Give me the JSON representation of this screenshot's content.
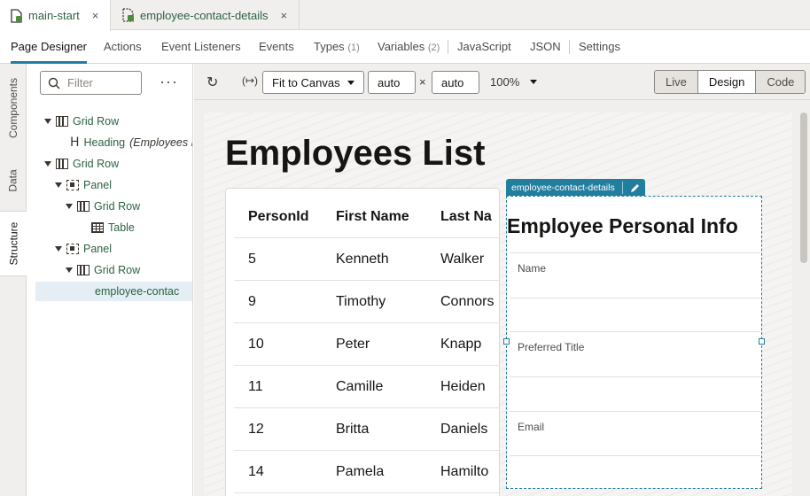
{
  "file_tabs": [
    {
      "label": "main-start",
      "close": "×"
    },
    {
      "label": "employee-contact-details",
      "close": "×"
    }
  ],
  "designer_tabs": {
    "page_designer": "Page Designer",
    "actions": "Actions",
    "event_listeners": "Event Listeners",
    "events": "Events",
    "types": "Types",
    "types_count": "(1)",
    "variables": "Variables",
    "variables_count": "(2)",
    "javascript": "JavaScript",
    "json": "JSON",
    "settings": "Settings"
  },
  "side_rail": {
    "components": "Components",
    "data": "Data",
    "structure": "Structure"
  },
  "structure": {
    "filter_placeholder": "Filter",
    "more": "···",
    "nodes": [
      {
        "label": "Grid Row"
      },
      {
        "label": "Heading",
        "extra": "(Employees L"
      },
      {
        "label": "Grid Row"
      },
      {
        "label": "Panel"
      },
      {
        "label": "Grid Row"
      },
      {
        "label": "Table"
      },
      {
        "label": "Panel"
      },
      {
        "label": "Grid Row"
      },
      {
        "label": "employee-contac"
      }
    ]
  },
  "toolbar": {
    "fit": "Fit to Canvas",
    "width": "auto",
    "times": "×",
    "height": "auto",
    "zoom": "100%",
    "live": "Live",
    "design": "Design",
    "code": "Code",
    "refresh_icon": "↻",
    "expr_icon": "(↦)"
  },
  "canvas": {
    "heading": "Employees List",
    "table": {
      "headers": [
        "PersonId",
        "First Name",
        "Last Na"
      ],
      "rows": [
        [
          "5",
          "Kenneth",
          "Walker"
        ],
        [
          "9",
          "Timothy",
          "Connors"
        ],
        [
          "10",
          "Peter",
          "Knapp"
        ],
        [
          "11",
          "Camille",
          "Heiden"
        ],
        [
          "12",
          "Britta",
          "Daniels"
        ],
        [
          "14",
          "Pamela",
          "Hamilto"
        ]
      ]
    },
    "fragment": {
      "tag": "employee-contact-details",
      "title": "Employee Personal Info",
      "fields": [
        "Name",
        "Preferred Title",
        "Email"
      ]
    }
  },
  "colors": {
    "accent": "#227e9e",
    "tree_text": "#2b6242",
    "selection": "#e4eef4"
  }
}
